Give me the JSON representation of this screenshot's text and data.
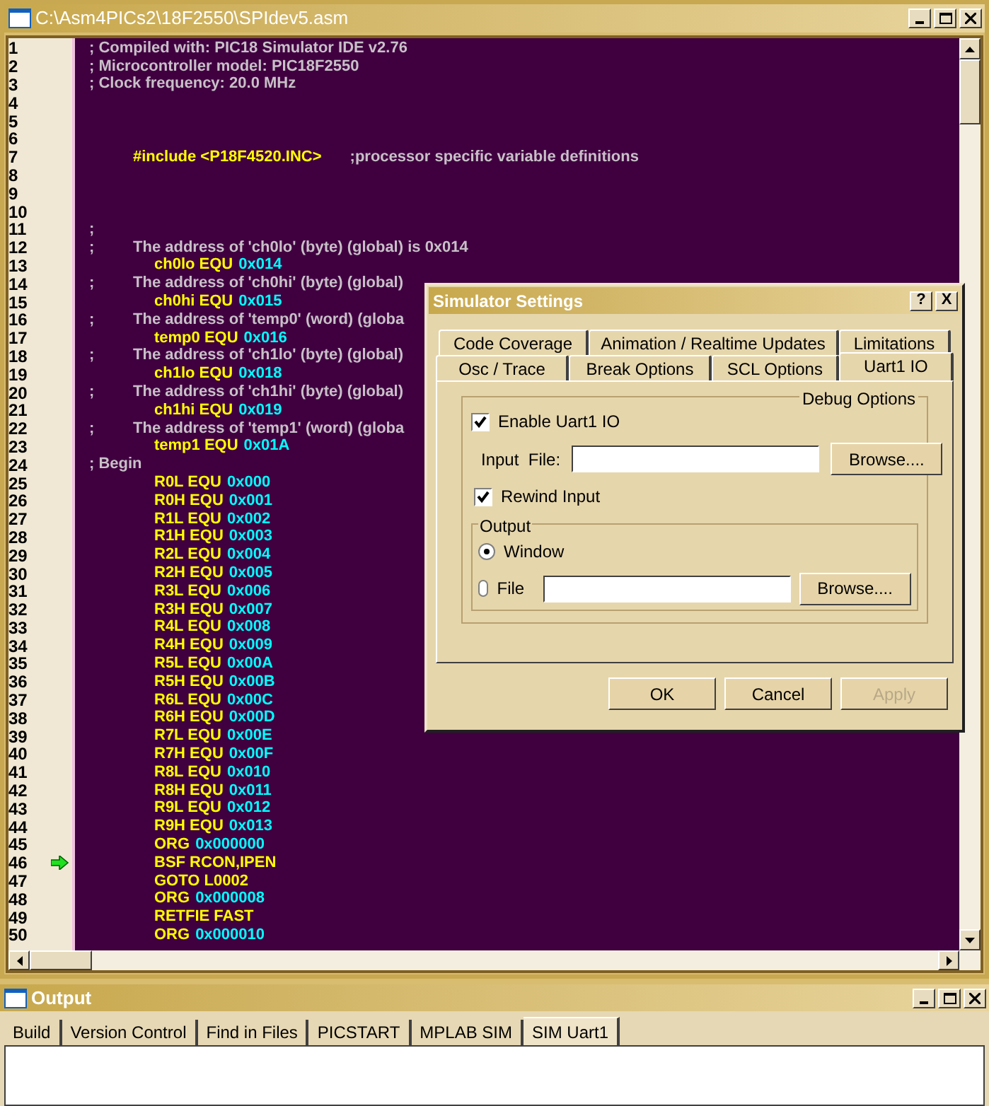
{
  "editor": {
    "title": "C:\\Asm4PICs2\\18F2550\\SPIdev5.asm",
    "lines": [
      {
        "number": "1",
        "kind": "comment",
        "current": false,
        "segments": [
          {
            "text": "; Compiled with: PIC18 Simulator IDE v2.76",
            "kind": "comment"
          }
        ]
      },
      {
        "number": "2",
        "kind": "comment",
        "current": false,
        "segments": [
          {
            "text": "; Microcontroller model: PIC18F2550",
            "kind": "comment"
          }
        ]
      },
      {
        "number": "3",
        "kind": "comment",
        "current": false,
        "segments": [
          {
            "text": "; Clock frequency: 20.0 MHz",
            "kind": "comment"
          }
        ]
      },
      {
        "number": "4",
        "kind": "blank",
        "current": false
      },
      {
        "number": "5",
        "kind": "blank",
        "current": false
      },
      {
        "number": "6",
        "kind": "blank",
        "current": false
      },
      {
        "number": "7",
        "kind": "include",
        "current": false,
        "segments": [
          {
            "text": "#include <P18F4520.INC>",
            "kind": "symbol"
          },
          {
            "text": ";processor specific variable definitions",
            "kind": "comment"
          }
        ]
      },
      {
        "number": "8",
        "kind": "blank",
        "current": false
      },
      {
        "number": "9",
        "kind": "blank",
        "current": false
      },
      {
        "number": "10",
        "kind": "blank",
        "current": false
      },
      {
        "number": "11",
        "kind": "comment",
        "current": false,
        "segments": [
          {
            "text": ";",
            "kind": "comment"
          }
        ]
      },
      {
        "number": "12",
        "kind": "note",
        "current": false,
        "segments": [
          {
            "text": ";",
            "kind": "comment"
          },
          {
            "text": "The address of 'ch0lo' (byte) (global) is 0x014",
            "kind": "comment"
          }
        ]
      },
      {
        "number": "13",
        "kind": "code",
        "current": false,
        "segments": [
          {
            "text": "ch0lo EQU",
            "kind": "symbol"
          },
          {
            "text": "0x014",
            "kind": "number"
          }
        ]
      },
      {
        "number": "14",
        "kind": "note",
        "current": false,
        "segments": [
          {
            "text": ";",
            "kind": "comment"
          },
          {
            "text": "The address of 'ch0hi' (byte) (global)",
            "kind": "comment"
          }
        ]
      },
      {
        "number": "15",
        "kind": "code",
        "current": false,
        "segments": [
          {
            "text": "ch0hi EQU",
            "kind": "symbol"
          },
          {
            "text": "0x015",
            "kind": "number"
          }
        ]
      },
      {
        "number": "16",
        "kind": "note",
        "current": false,
        "segments": [
          {
            "text": ";",
            "kind": "comment"
          },
          {
            "text": "The address of 'temp0' (word) (globa",
            "kind": "comment"
          }
        ]
      },
      {
        "number": "17",
        "kind": "code",
        "current": false,
        "segments": [
          {
            "text": "temp0 EQU",
            "kind": "symbol"
          },
          {
            "text": "0x016",
            "kind": "number"
          }
        ]
      },
      {
        "number": "18",
        "kind": "note",
        "current": false,
        "segments": [
          {
            "text": ";",
            "kind": "comment"
          },
          {
            "text": "The address of 'ch1lo' (byte) (global)",
            "kind": "comment"
          }
        ]
      },
      {
        "number": "19",
        "kind": "code",
        "current": false,
        "segments": [
          {
            "text": "ch1lo EQU",
            "kind": "symbol"
          },
          {
            "text": "0x018",
            "kind": "number"
          }
        ]
      },
      {
        "number": "20",
        "kind": "note",
        "current": false,
        "segments": [
          {
            "text": ";",
            "kind": "comment"
          },
          {
            "text": "The address of 'ch1hi' (byte) (global)",
            "kind": "comment"
          }
        ]
      },
      {
        "number": "21",
        "kind": "code",
        "current": false,
        "segments": [
          {
            "text": "ch1hi EQU",
            "kind": "symbol"
          },
          {
            "text": "0x019",
            "kind": "number"
          }
        ]
      },
      {
        "number": "22",
        "kind": "note",
        "current": false,
        "segments": [
          {
            "text": ";",
            "kind": "comment"
          },
          {
            "text": "The address of 'temp1' (word) (globa",
            "kind": "comment"
          }
        ]
      },
      {
        "number": "23",
        "kind": "code",
        "current": false,
        "segments": [
          {
            "text": "temp1 EQU",
            "kind": "symbol"
          },
          {
            "text": "0x01A",
            "kind": "number"
          }
        ]
      },
      {
        "number": "24",
        "kind": "comment",
        "current": false,
        "segments": [
          {
            "text": "; Begin",
            "kind": "comment"
          }
        ]
      },
      {
        "number": "25",
        "kind": "code",
        "current": false,
        "segments": [
          {
            "text": "R0L EQU",
            "kind": "symbol"
          },
          {
            "text": "0x000",
            "kind": "number"
          }
        ]
      },
      {
        "number": "26",
        "kind": "code",
        "current": false,
        "segments": [
          {
            "text": "R0H EQU",
            "kind": "symbol"
          },
          {
            "text": "0x001",
            "kind": "number"
          }
        ]
      },
      {
        "number": "27",
        "kind": "code",
        "current": false,
        "segments": [
          {
            "text": "R1L EQU",
            "kind": "symbol"
          },
          {
            "text": "0x002",
            "kind": "number"
          }
        ]
      },
      {
        "number": "28",
        "kind": "code",
        "current": false,
        "segments": [
          {
            "text": "R1H EQU",
            "kind": "symbol"
          },
          {
            "text": "0x003",
            "kind": "number"
          }
        ]
      },
      {
        "number": "29",
        "kind": "code",
        "current": false,
        "segments": [
          {
            "text": "R2L EQU",
            "kind": "symbol"
          },
          {
            "text": "0x004",
            "kind": "number"
          }
        ]
      },
      {
        "number": "30",
        "kind": "code",
        "current": false,
        "segments": [
          {
            "text": "R2H EQU",
            "kind": "symbol"
          },
          {
            "text": "0x005",
            "kind": "number"
          }
        ]
      },
      {
        "number": "31",
        "kind": "code",
        "current": false,
        "segments": [
          {
            "text": "R3L EQU",
            "kind": "symbol"
          },
          {
            "text": "0x006",
            "kind": "number"
          }
        ]
      },
      {
        "number": "32",
        "kind": "code",
        "current": false,
        "segments": [
          {
            "text": "R3H EQU",
            "kind": "symbol"
          },
          {
            "text": "0x007",
            "kind": "number"
          }
        ]
      },
      {
        "number": "33",
        "kind": "code",
        "current": false,
        "segments": [
          {
            "text": "R4L EQU",
            "kind": "symbol"
          },
          {
            "text": "0x008",
            "kind": "number"
          }
        ]
      },
      {
        "number": "34",
        "kind": "code",
        "current": false,
        "segments": [
          {
            "text": "R4H EQU",
            "kind": "symbol"
          },
          {
            "text": "0x009",
            "kind": "number"
          }
        ]
      },
      {
        "number": "35",
        "kind": "code",
        "current": false,
        "segments": [
          {
            "text": "R5L EQU",
            "kind": "symbol"
          },
          {
            "text": "0x00A",
            "kind": "number"
          }
        ]
      },
      {
        "number": "36",
        "kind": "code",
        "current": false,
        "segments": [
          {
            "text": "R5H EQU",
            "kind": "symbol"
          },
          {
            "text": "0x00B",
            "kind": "number"
          }
        ]
      },
      {
        "number": "37",
        "kind": "code",
        "current": false,
        "segments": [
          {
            "text": "R6L EQU",
            "kind": "symbol"
          },
          {
            "text": "0x00C",
            "kind": "number"
          }
        ]
      },
      {
        "number": "38",
        "kind": "code",
        "current": false,
        "segments": [
          {
            "text": "R6H EQU",
            "kind": "symbol"
          },
          {
            "text": "0x00D",
            "kind": "number"
          }
        ]
      },
      {
        "number": "39",
        "kind": "code",
        "current": false,
        "segments": [
          {
            "text": "R7L EQU",
            "kind": "symbol"
          },
          {
            "text": "0x00E",
            "kind": "number"
          }
        ]
      },
      {
        "number": "40",
        "kind": "code",
        "current": false,
        "segments": [
          {
            "text": "R7H EQU",
            "kind": "symbol"
          },
          {
            "text": "0x00F",
            "kind": "number"
          }
        ]
      },
      {
        "number": "41",
        "kind": "code",
        "current": false,
        "segments": [
          {
            "text": "R8L EQU",
            "kind": "symbol"
          },
          {
            "text": "0x010",
            "kind": "number"
          }
        ]
      },
      {
        "number": "42",
        "kind": "code",
        "current": false,
        "segments": [
          {
            "text": "R8H EQU",
            "kind": "symbol"
          },
          {
            "text": "0x011",
            "kind": "number"
          }
        ]
      },
      {
        "number": "43",
        "kind": "code",
        "current": false,
        "segments": [
          {
            "text": "R9L EQU",
            "kind": "symbol"
          },
          {
            "text": "0x012",
            "kind": "number"
          }
        ]
      },
      {
        "number": "44",
        "kind": "code",
        "current": false,
        "segments": [
          {
            "text": "R9H EQU",
            "kind": "symbol"
          },
          {
            "text": "0x013",
            "kind": "number"
          }
        ]
      },
      {
        "number": "45",
        "kind": "code",
        "current": false,
        "segments": [
          {
            "text": "ORG",
            "kind": "symbol"
          },
          {
            "text": "0x000000",
            "kind": "number"
          }
        ]
      },
      {
        "number": "46",
        "kind": "code",
        "current": true,
        "segments": [
          {
            "text": "BSF RCON,IPEN",
            "kind": "symbol"
          }
        ]
      },
      {
        "number": "47",
        "kind": "code",
        "current": false,
        "segments": [
          {
            "text": "GOTO L0002",
            "kind": "symbol"
          }
        ]
      },
      {
        "number": "48",
        "kind": "code",
        "current": false,
        "segments": [
          {
            "text": "ORG",
            "kind": "symbol"
          },
          {
            "text": "0x000008",
            "kind": "number"
          }
        ]
      },
      {
        "number": "49",
        "kind": "code",
        "current": false,
        "segments": [
          {
            "text": "RETFIE FAST",
            "kind": "symbol"
          }
        ]
      },
      {
        "number": "50",
        "kind": "code",
        "current": false,
        "segments": [
          {
            "text": "ORG",
            "kind": "symbol"
          },
          {
            "text": "0x000010",
            "kind": "number"
          }
        ]
      }
    ]
  },
  "dialog": {
    "title": "Simulator Settings",
    "help_button": "?",
    "close_button": "X",
    "tab_rows": [
      [
        {
          "label": "Code Coverage",
          "selected": false
        },
        {
          "label": "Animation / Realtime  Updates",
          "selected": false
        },
        {
          "label": "Limitations",
          "selected": false
        }
      ],
      [
        {
          "label": "Osc / Trace",
          "selected": false
        },
        {
          "label": "Break Options",
          "selected": false
        },
        {
          "label": "SCL Options",
          "selected": false
        },
        {
          "label": "Uart1  IO",
          "selected": true
        }
      ]
    ],
    "group_title": "Debug Options",
    "enable": {
      "label": "Enable Uart1 IO",
      "checked": true
    },
    "input_file": {
      "label": "Input  File:",
      "browse": "Browse...."
    },
    "rewind": {
      "label": "Rewind Input",
      "checked": true
    },
    "output": {
      "title": "Output",
      "options": [
        {
          "label": "Window",
          "selected": true,
          "kind": "plain"
        },
        {
          "label": "File",
          "selected": false,
          "kind": "file",
          "browse": "Browse...."
        }
      ]
    },
    "buttons": [
      {
        "label": "OK",
        "disabled": false
      },
      {
        "label": "Cancel",
        "disabled": false
      },
      {
        "label": "Apply",
        "disabled": true
      }
    ]
  },
  "output_window": {
    "title": "Output",
    "tabs": [
      {
        "label": "Build",
        "selected": false
      },
      {
        "label": "Version Control",
        "selected": false
      },
      {
        "label": "Find in Files",
        "selected": false
      },
      {
        "label": "PICSTART",
        "selected": false
      },
      {
        "label": "MPLAB SIM",
        "selected": false
      },
      {
        "label": "SIM Uart1",
        "selected": true
      }
    ]
  }
}
